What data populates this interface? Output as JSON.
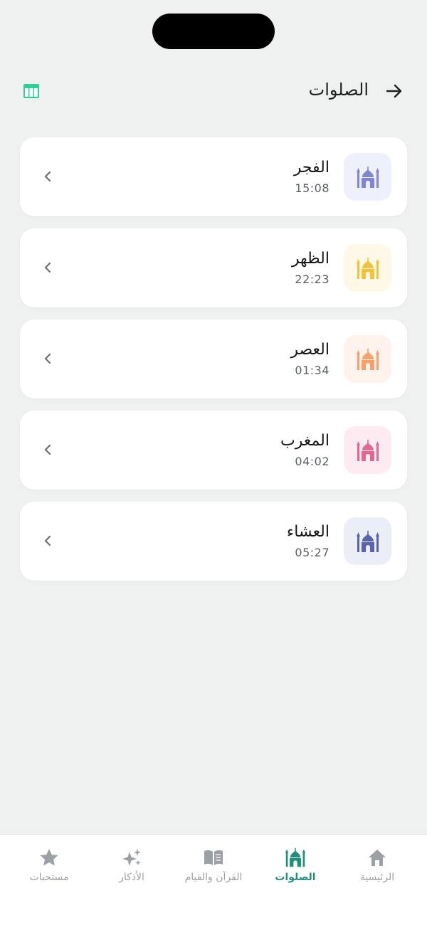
{
  "header": {
    "title": "الصلوات",
    "back_icon": "arrow-right-icon",
    "calendar_icon": "calendar-table-icon"
  },
  "prayers": [
    {
      "name": "الفجر",
      "time": "15:08",
      "color": "#7f86d6",
      "bg": "#eef0fb"
    },
    {
      "name": "الظهر",
      "time": "22:23",
      "color": "#f2c23a",
      "bg": "#fff8e6"
    },
    {
      "name": "العصر",
      "time": "01:34",
      "color": "#f7a06a",
      "bg": "#fff2ec"
    },
    {
      "name": "المغرب",
      "time": "04:02",
      "color": "#e2678f",
      "bg": "#fdebf1"
    },
    {
      "name": "العشاء",
      "time": "05:27",
      "color": "#5964ad",
      "bg": "#eceef7"
    }
  ],
  "tabs": [
    {
      "label": "الرئيسية",
      "icon": "home-icon"
    },
    {
      "label": "الصلوات",
      "icon": "mosque-icon",
      "active": true
    },
    {
      "label": "القرآن والقيام",
      "icon": "book-icon"
    },
    {
      "label": "الأذكار",
      "icon": "sparkles-icon"
    },
    {
      "label": "مستحبات",
      "icon": "star-icon"
    }
  ],
  "colors": {
    "accent": "#1e8f7a",
    "calendar": "#2ecf9a",
    "inactive": "#9aa0a6",
    "background": "#eef1f0"
  }
}
